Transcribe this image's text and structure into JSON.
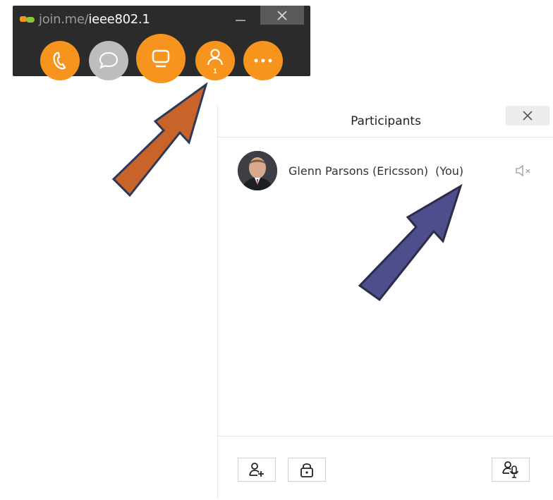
{
  "toolbar": {
    "url_prefix": "join.me/",
    "room_name": "ieee802.1",
    "people_count": "1",
    "logo_colors": [
      "#f7941d",
      "#8cc63f"
    ],
    "buttons": [
      "phone-icon",
      "chat-icon",
      "screen-share-icon",
      "participants-icon",
      "more-icon"
    ],
    "accent": "#f7941d"
  },
  "participants_panel": {
    "title": "Participants",
    "participants": [
      {
        "name": "Glenn Parsons (Ericsson)",
        "tag": "(You)",
        "status_icon": "speaker-muted-icon"
      }
    ],
    "footer": [
      "invite-person-icon",
      "lock-icon",
      "mute-all-icon"
    ]
  },
  "annotations": {
    "arrow_1_color": "#c8642a",
    "arrow_2_color": "#4e4e8c"
  }
}
